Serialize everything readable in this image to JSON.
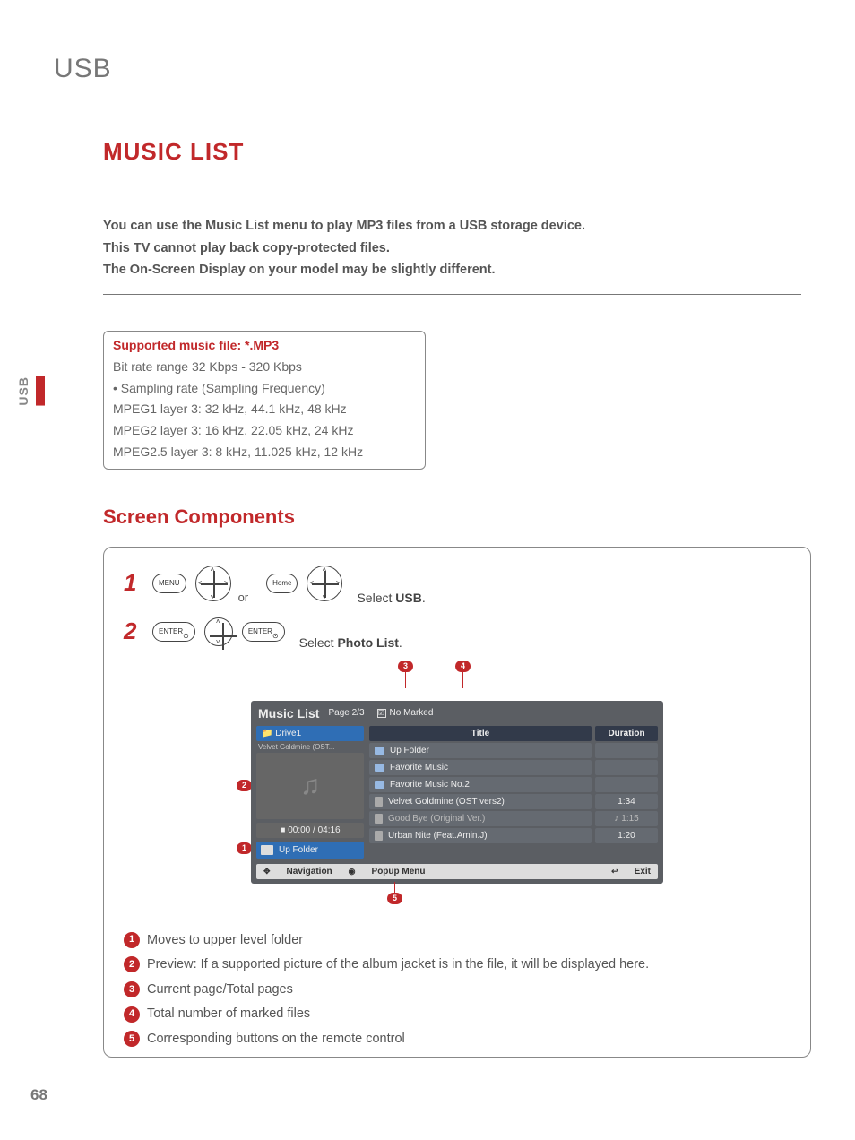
{
  "chapter": "USB",
  "side_tab": "USB",
  "page_number": "68",
  "title": "MUSIC LIST",
  "intro": {
    "l1": "You can use the Music List menu to play MP3 files from a USB storage device.",
    "l2": "This TV cannot play back copy-protected files.",
    "l3": "The On-Screen Display on your model may be slightly different."
  },
  "supported": {
    "heading": "Supported music file: *.MP3",
    "bitrate": "Bit rate range 32 Kbps - 320 Kbps",
    "sampling_h": "• Sampling rate (Sampling Frequency)",
    "l1": "MPEG1 layer 3: 32 kHz, 44.1 kHz, 48 kHz",
    "l2": "MPEG2 layer 3: 16 kHz, 22.05 kHz, 24 kHz",
    "l3": "MPEG2.5 layer 3: 8 kHz, 11.025 kHz, 12 kHz"
  },
  "subheading": "Screen Components",
  "steps": {
    "s1": {
      "num": "1",
      "menu": "MENU",
      "home": "Home",
      "or": "or",
      "text_a": "Select ",
      "text_b": "USB",
      "text_c": "."
    },
    "s2": {
      "num": "2",
      "enter": "ENTER",
      "text_a": "Select ",
      "text_b": "Photo List",
      "text_c": "."
    }
  },
  "osd": {
    "title": "Music List",
    "page": "Page 2/3",
    "no_marked": "No Marked",
    "check": "☑",
    "drive": "Drive1",
    "preview_caption": "Velvet Goldmine (OST...",
    "time": "00:00 / 04:16",
    "up_folder_left": "Up Folder",
    "header_title": "Title",
    "header_duration": "Duration",
    "rows": [
      {
        "title": "Up Folder",
        "dur": "",
        "folder": true
      },
      {
        "title": "Favorite Music",
        "dur": "",
        "folder": true
      },
      {
        "title": "Favorite Music No.2",
        "dur": "",
        "folder": true
      },
      {
        "title": "Velvet Goldmine (OST vers2)",
        "dur": "1:34"
      },
      {
        "title": "Good Bye (Original Ver.)",
        "dur": "1:15",
        "dim": true,
        "playing": true
      },
      {
        "title": "Urban Nite (Feat.Amin.J)",
        "dur": "1:20"
      }
    ],
    "footer": {
      "nav": "Navigation",
      "popup": "Popup Menu",
      "exit": "Exit"
    }
  },
  "callouts": {
    "c1": "1",
    "c2": "2",
    "c3": "3",
    "c4": "4",
    "c5": "5"
  },
  "legend": {
    "l1": "Moves to upper level folder",
    "l2": "Preview: If a supported picture of the album jacket is in the file, it will be displayed here.",
    "l3": "Current page/Total pages",
    "l4": "Total number of marked files",
    "l5": "Corresponding buttons on the remote control"
  }
}
